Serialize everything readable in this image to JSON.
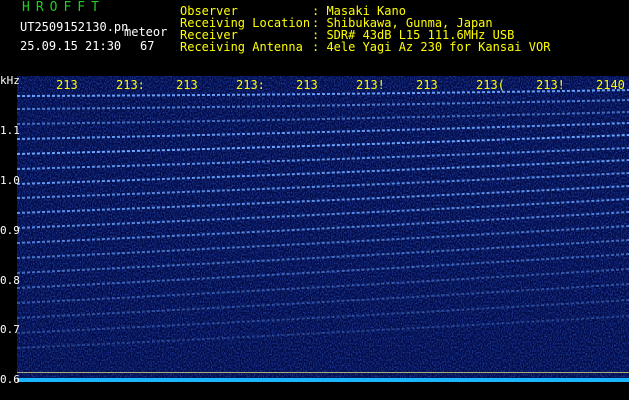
{
  "app": {
    "title": "HROFFT",
    "filename": "UT2509152130.pn",
    "mode": "meteor",
    "datetime": "25.09.15 21:30",
    "count": "67"
  },
  "info": [
    {
      "label": "Observer",
      "value": ": Masaki Kano"
    },
    {
      "label": "Receiving Location",
      "value": ": Shibukawa, Gunma, Japan"
    },
    {
      "label": "Receiver",
      "value": ": SDR# 43dB L15 111.6MHz USB"
    },
    {
      "label": "Receiving Antenna",
      "value": ": 4ele Yagi Az 230 for Kansai VOR"
    }
  ],
  "axis": {
    "unit": "kHz",
    "y_ticks": [
      "1.1",
      "1.0",
      "0.9",
      "0.8",
      "0.7",
      "0.6"
    ],
    "x_ticks": [
      "213",
      "213:",
      "213",
      "213:",
      "213",
      "213!",
      "213",
      "213(",
      "213!",
      "2140"
    ]
  },
  "colors": {
    "background": "#000000",
    "header_text": "#ffff00",
    "title": "#22cc22",
    "spectrogram_base": "#000a50",
    "signal": "#4f8cff"
  }
}
